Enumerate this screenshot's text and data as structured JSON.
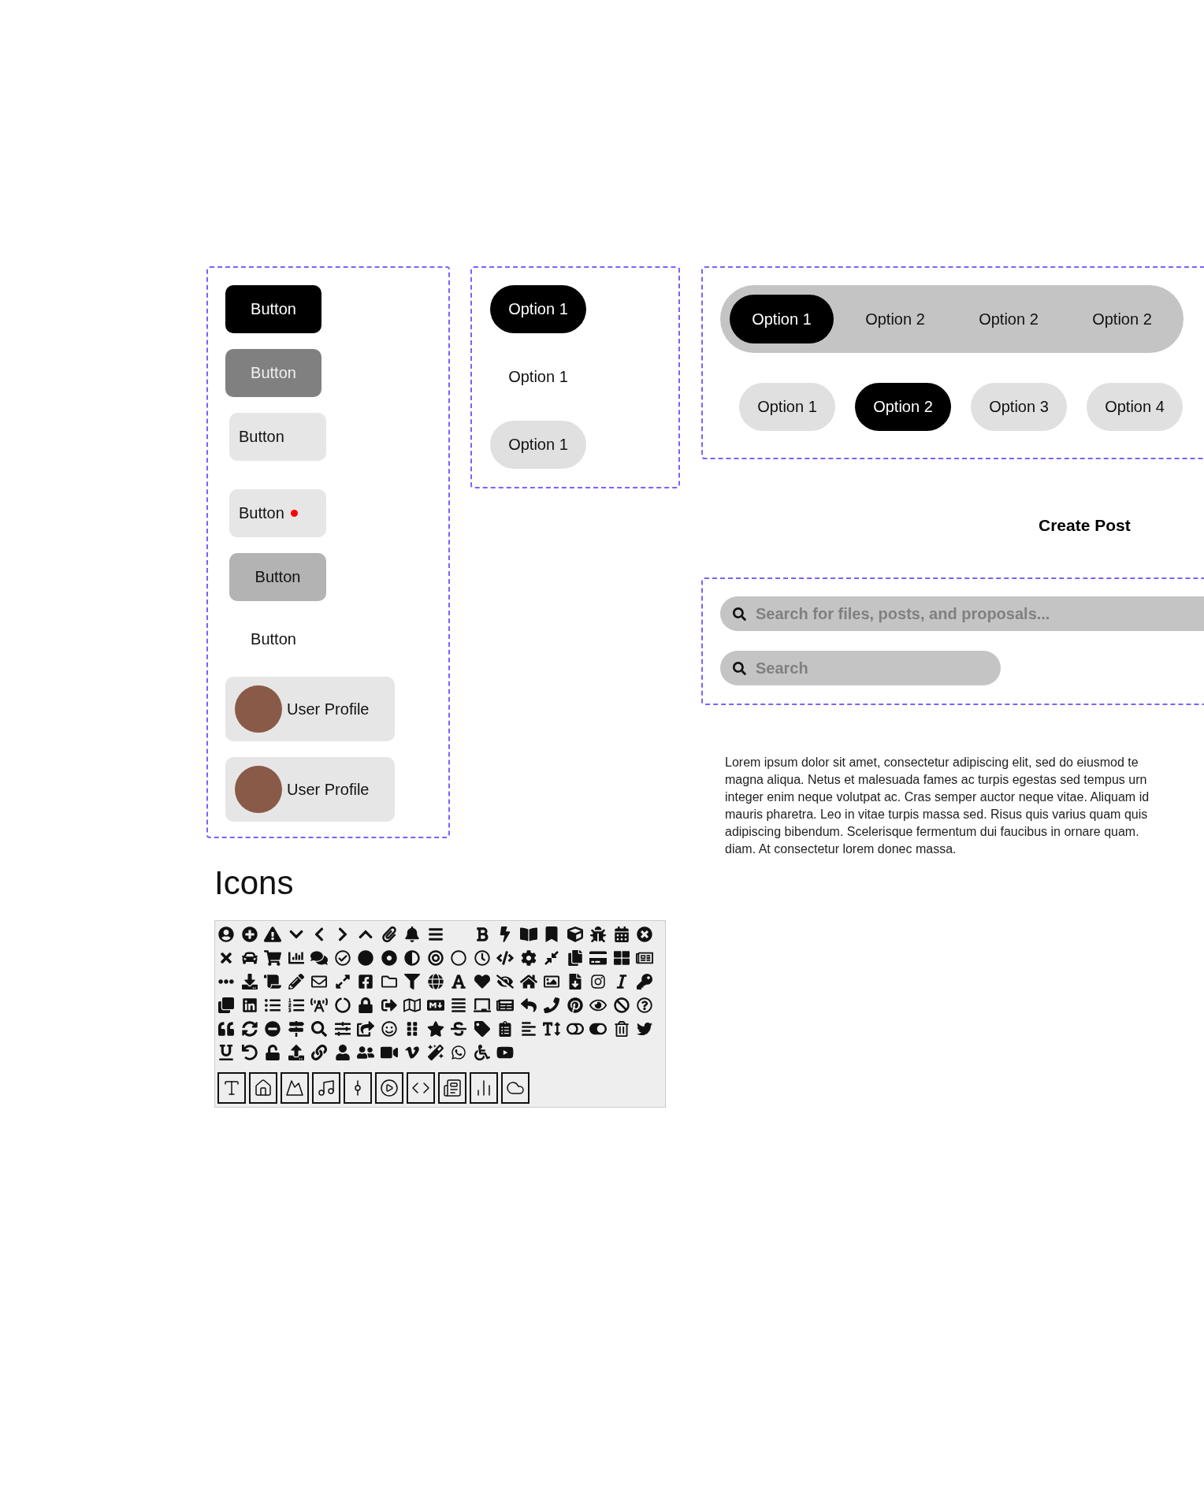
{
  "button_panel": {
    "buttons": [
      {
        "kind": "primary",
        "label": "Button"
      },
      {
        "kind": "secondary",
        "label": "Button"
      },
      {
        "kind": "light",
        "label": "Button"
      },
      {
        "kind": "light-dot",
        "label": "Button"
      },
      {
        "kind": "muted",
        "label": "Button"
      },
      {
        "kind": "text",
        "label": "Button"
      },
      {
        "kind": "profile",
        "label": "User Profile"
      },
      {
        "kind": "profile",
        "label": "User Profile"
      }
    ]
  },
  "option_panel": {
    "options": [
      {
        "kind": "filled",
        "label": "Option 1"
      },
      {
        "kind": "text",
        "label": "Option 1"
      },
      {
        "kind": "soft",
        "label": "Option 1"
      }
    ]
  },
  "segmented_control": {
    "options": [
      {
        "label": "Option 1",
        "selected": true
      },
      {
        "label": "Option 2",
        "selected": false
      },
      {
        "label": "Option 2",
        "selected": false
      },
      {
        "label": "Option 2",
        "selected": false
      }
    ]
  },
  "chips": [
    {
      "label": "Option 1",
      "selected": false
    },
    {
      "label": "Option 2",
      "selected": true
    },
    {
      "label": "Option 3",
      "selected": false
    },
    {
      "label": "Option 4",
      "selected": false
    }
  ],
  "create_post": "Create Post",
  "search_fields": [
    {
      "kind": "wide",
      "placeholder": "Search for files, posts, and proposals..."
    },
    {
      "kind": "compact",
      "placeholder": "Search"
    }
  ],
  "paragraph_lines": [
    "Lorem ipsum dolor sit amet, consectetur adipiscing elit, sed do eiusmod te",
    "magna aliqua. Netus et malesuada fames ac turpis egestas sed tempus urn",
    "integer enim neque volutpat ac. Cras semper auctor neque vitae. Aliquam id",
    "mauris pharetra. Leo in vitae turpis massa sed. Risus quis varius quam quis",
    "adipiscing bibendum. Scelerisque fermentum dui faucibus in ornare quam.",
    "diam. At consectetur lorem donec massa."
  ],
  "icons_heading": "Icons"
}
